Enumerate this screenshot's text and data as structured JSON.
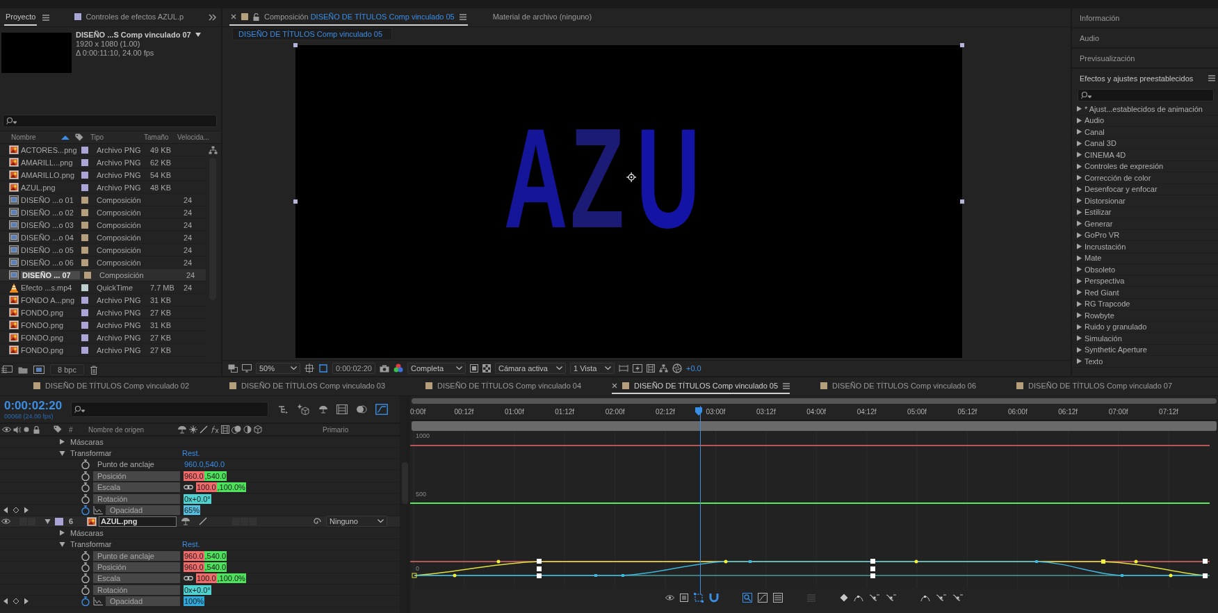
{
  "project": {
    "tabs": [
      {
        "label": "Proyecto",
        "selected": true
      },
      {
        "label": "Controles de efectos  AZUL.p",
        "selected": false
      }
    ],
    "preview": {
      "title": "DISEÑO ...S Comp vinculado 07",
      "dimensions": "1920 x 1080 (1.00)",
      "duration": "Δ 0:00:11:10, 24.00 fps"
    },
    "columns": [
      "Nombre",
      "Tipo",
      "Tamaño",
      "Velocida..."
    ],
    "items": [
      {
        "name": "ACTORES...png",
        "kind": "image",
        "color": "#a9a5d6",
        "type": "Archivo PNG",
        "size": "49 KB",
        "selected": false
      },
      {
        "name": "AMARILL...png",
        "kind": "image",
        "color": "#a9a5d6",
        "type": "Archivo PNG",
        "size": "62 KB",
        "selected": false
      },
      {
        "name": "AMARILLO.png",
        "kind": "image",
        "color": "#a9a5d6",
        "type": "Archivo PNG",
        "size": "54 KB",
        "selected": false
      },
      {
        "name": "AZUL.png",
        "kind": "image",
        "color": "#a9a5d6",
        "type": "Archivo PNG",
        "size": "48 KB",
        "selected": false
      },
      {
        "name": "DISEÑO ...o 01",
        "kind": "composition",
        "color": "#b59e7c",
        "type": "Composición",
        "rate": "24",
        "selected": false
      },
      {
        "name": "DISEÑO ...o 02",
        "kind": "composition",
        "color": "#b59e7c",
        "type": "Composición",
        "rate": "24",
        "selected": false
      },
      {
        "name": "DISEÑO ...o 03",
        "kind": "composition",
        "color": "#b59e7c",
        "type": "Composición",
        "rate": "24",
        "selected": false
      },
      {
        "name": "DISEÑO ...o 04",
        "kind": "composition",
        "color": "#b59e7c",
        "type": "Composición",
        "rate": "24",
        "selected": false
      },
      {
        "name": "DISEÑO ...o 05",
        "kind": "composition",
        "color": "#b59e7c",
        "type": "Composición",
        "rate": "24",
        "selected": false
      },
      {
        "name": "DISEÑO ...o 06",
        "kind": "composition",
        "color": "#b59e7c",
        "type": "Composición",
        "rate": "24",
        "selected": false
      },
      {
        "name": "DISEÑO ... 07",
        "kind": "composition",
        "color": "#b59e7c",
        "type": "Composición",
        "rate": "24",
        "selected": true
      },
      {
        "name": "Efecto ...s.mp4",
        "kind": "video",
        "color": "#bccfcf",
        "type": "QuickTime",
        "size": "7.7 MB",
        "rate": "24",
        "selected": false
      },
      {
        "name": "FONDO A...png",
        "kind": "image",
        "color": "#a9a5d6",
        "type": "Archivo PNG",
        "size": "31 KB",
        "selected": false
      },
      {
        "name": "FONDO.png",
        "kind": "image",
        "color": "#a9a5d6",
        "type": "Archivo PNG",
        "size": "27 KB",
        "selected": false
      },
      {
        "name": "FONDO.png",
        "kind": "image",
        "color": "#a9a5d6",
        "type": "Archivo PNG",
        "size": "31 KB",
        "selected": false
      },
      {
        "name": "FONDO.png",
        "kind": "image",
        "color": "#a9a5d6",
        "type": "Archivo PNG",
        "size": "27 KB",
        "selected": false
      },
      {
        "name": "FONDO.png",
        "kind": "image",
        "color": "#a9a5d6",
        "type": "Archivo PNG",
        "size": "27 KB",
        "selected": false
      }
    ],
    "bpc": "8 bpc"
  },
  "viewer": {
    "tabs": [
      {
        "prefix": "Composición",
        "label": "DISEÑO DE TÍTULOS Comp vinculado 05",
        "selected": true
      },
      {
        "label": "Material de archivo  (ninguno)",
        "selected": false
      }
    ],
    "breadcrumb": "DISEÑO DE TÍTULOS Comp vinculado 05",
    "canvas_text": [
      {
        "char": "A",
        "color": "#15159a"
      },
      {
        "char": "Z",
        "color": "#1b1b76"
      },
      {
        "char": "U",
        "color": "#1313a6"
      }
    ],
    "toolbar": {
      "zoom": "50%",
      "timecode": "0:00:02:20",
      "resolution": "Completa",
      "camera": "Cámara activa",
      "views": "1 Vista",
      "exposure": "+0.0"
    }
  },
  "panels": {
    "collapsed": [
      "Información",
      "Audio",
      "Previsualización"
    ],
    "effects": {
      "title": "Efectos y ajustes preestablecidos",
      "items": [
        {
          "label": "* Ajust...establecidos de animación",
          "expanded": false
        },
        {
          "label": "Audio",
          "expanded": false
        },
        {
          "label": "Canal",
          "expanded": false
        },
        {
          "label": "Canal 3D",
          "expanded": false
        },
        {
          "label": "CINEMA 4D",
          "expanded": false
        },
        {
          "label": "Controles de expresión",
          "expanded": false
        },
        {
          "label": "Corrección de color",
          "expanded": false
        },
        {
          "label": "Desenfocar y enfocar",
          "expanded": false
        },
        {
          "label": "Distorsionar",
          "expanded": false
        },
        {
          "label": "Estilizar",
          "expanded": false
        },
        {
          "label": "Generar",
          "expanded": false
        },
        {
          "label": "GoPro VR",
          "expanded": false
        },
        {
          "label": "Incrustación",
          "expanded": false
        },
        {
          "label": "Mate",
          "expanded": false
        },
        {
          "label": "Obsoleto",
          "expanded": false
        },
        {
          "label": "Perspectiva",
          "expanded": false
        },
        {
          "label": "Red Giant",
          "expanded": false
        },
        {
          "label": "RG Trapcode",
          "expanded": false
        },
        {
          "label": "Rowbyte",
          "expanded": false
        },
        {
          "label": "Ruido y granulado",
          "expanded": false
        },
        {
          "label": "Simulación",
          "expanded": false
        },
        {
          "label": "Synthetic Aperture",
          "expanded": false
        },
        {
          "label": "Texto",
          "expanded": false
        }
      ]
    }
  },
  "timeline": {
    "tabs": [
      {
        "label": "DISEÑO DE TÍTULOS Comp vinculado 02",
        "selected": false
      },
      {
        "label": "DISEÑO DE TÍTULOS Comp vinculado 03",
        "selected": false
      },
      {
        "label": "DISEÑO DE TÍTULOS Comp vinculado 04",
        "selected": false
      },
      {
        "label": "DISEÑO DE TÍTULOS Comp vinculado 05",
        "selected": true
      },
      {
        "label": "DISEÑO DE TÍTULOS Comp vinculado 06",
        "selected": false
      },
      {
        "label": "DISEÑO DE TÍTULOS Comp vinculado 07",
        "selected": false
      }
    ],
    "time": "0:00:02:20",
    "frame_info": "00068 (24.00 fps)",
    "columns": {
      "number": "#",
      "name": "Nombre de origen",
      "parent": "Primario"
    },
    "layers": [
      {
        "groups": [
          {
            "label": "Máscaras",
            "expanded": false
          },
          {
            "label": "Transformar",
            "expanded": true,
            "reset": "Rest.",
            "children": [
              {
                "label": "Punto de anclaje",
                "selected": false,
                "animated": false,
                "linked": false,
                "values": [
                  {
                    "text": "960.0,540.0"
                  }
                ]
              },
              {
                "label": "Posición",
                "selected": true,
                "animated": false,
                "linked": false,
                "values": [
                  {
                    "text": "960.0",
                    "color": "#f26b6b"
                  },
                  {
                    "text": ",540.0",
                    "color": "#4ee35c"
                  }
                ]
              },
              {
                "label": "Escala",
                "selected": true,
                "animated": false,
                "linked": true,
                "values": [
                  {
                    "text": "100.0",
                    "color": "#f26b6b"
                  },
                  {
                    "text": ",100.0%",
                    "color": "#4ee35c"
                  }
                ]
              },
              {
                "label": "Rotación",
                "selected": true,
                "animated": false,
                "linked": false,
                "values": [
                  {
                    "text": "0x+0.0°",
                    "color": "#4fd2d0"
                  }
                ]
              },
              {
                "label": "Opacidad",
                "selected": true,
                "animated": true,
                "linked": false,
                "values": [
                  {
                    "text": "65%",
                    "color": "#56bfe0"
                  }
                ]
              }
            ]
          }
        ]
      },
      {
        "header": {
          "number": "6",
          "name": "AZUL.png",
          "color": "#a9a5d6",
          "visible": true,
          "parent": "Ninguno"
        },
        "groups": [
          {
            "label": "Máscaras",
            "expanded": false
          },
          {
            "label": "Transformar",
            "expanded": true,
            "reset": "Rest.",
            "children": [
              {
                "label": "Punto de anclaje",
                "selected": true,
                "animated": false,
                "linked": false,
                "values": [
                  {
                    "text": "960.0",
                    "color": "#f26b6b"
                  },
                  {
                    "text": ",540.0",
                    "color": "#4ee35c"
                  }
                ]
              },
              {
                "label": "Posición",
                "selected": true,
                "animated": false,
                "linked": false,
                "values": [
                  {
                    "text": "960.0",
                    "color": "#f26b6b"
                  },
                  {
                    "text": ",540.0",
                    "color": "#4ee35c"
                  }
                ]
              },
              {
                "label": "Escala",
                "selected": true,
                "animated": false,
                "linked": true,
                "values": [
                  {
                    "text": "100.0",
                    "color": "#f26b6b"
                  },
                  {
                    "text": ",100.0%",
                    "color": "#4ee35c"
                  }
                ]
              },
              {
                "label": "Rotación",
                "selected": true,
                "animated": false,
                "linked": false,
                "values": [
                  {
                    "text": "0x+0.0°",
                    "color": "#4fd2d0"
                  }
                ]
              },
              {
                "label": "Opacidad",
                "selected": true,
                "animated": true,
                "linked": false,
                "values": [
                  {
                    "text": "100%",
                    "color": "#2ea9da"
                  }
                ]
              }
            ]
          }
        ]
      }
    ],
    "ruler": [
      "0:00f",
      "00:12f",
      "01:00f",
      "01:12f",
      "02:00f",
      "02:12f",
      "03:00f",
      "03:12f",
      "04:00f",
      "04:12f",
      "05:00f",
      "05:12f",
      "06:00f",
      "06:12f",
      "07:00f",
      "07:12f"
    ],
    "playhead": {
      "level": 0.362
    },
    "graph_labels": [
      "1000",
      "500",
      "0"
    ]
  }
}
